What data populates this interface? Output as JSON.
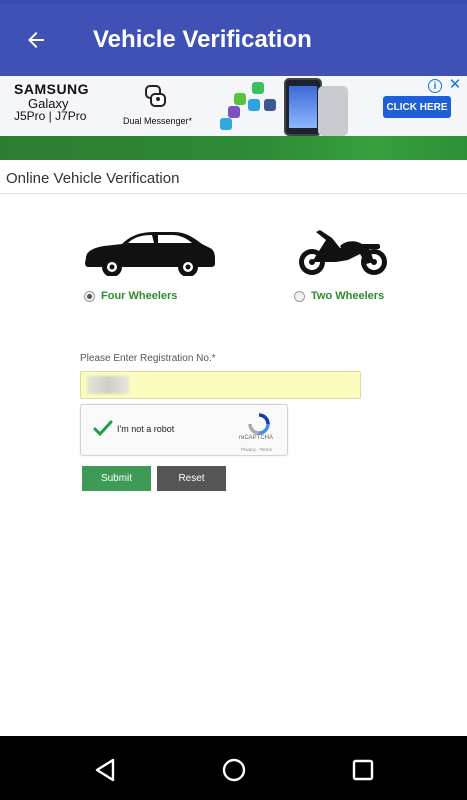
{
  "appbar": {
    "title": "Vehicle Verification",
    "back_icon": "arrow-back-icon"
  },
  "ad": {
    "brand_line1": "SAMSUNG",
    "brand_line2": "Galaxy",
    "brand_line3": "J5Pro | J7Pro",
    "feature": "Dual Messenger*",
    "cta": "CLICK HERE",
    "info_glyph": "i",
    "close_glyph": "✕"
  },
  "section": {
    "title": "Online Vehicle Verification"
  },
  "vehicle_types": [
    {
      "label": "Four Wheelers",
      "selected": true,
      "icon": "car-icon"
    },
    {
      "label": "Two Wheelers",
      "selected": false,
      "icon": "motorcycle-icon"
    }
  ],
  "form": {
    "reg_label": "Please Enter Registration No.*",
    "reg_value": "",
    "captcha_text": "I'm not a robot",
    "captcha_brand": "reCAPTCHA",
    "captcha_links": "Privacy - Terms",
    "submit_label": "Submit",
    "reset_label": "Reset"
  },
  "colors": {
    "appbar": "#3f51b5",
    "accent_green": "#2e8b2e",
    "submit": "#3e9b55",
    "reset": "#555555",
    "input_bg": "#fbfdbd"
  },
  "navbar": {
    "icons": [
      "back-triangle-icon",
      "home-circle-icon",
      "recents-square-icon"
    ]
  }
}
